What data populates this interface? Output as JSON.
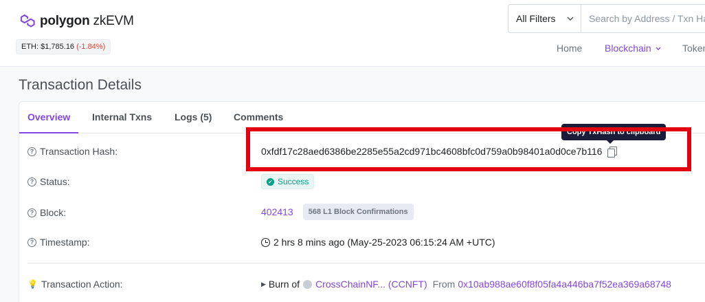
{
  "brand": {
    "name_bold": "polygon",
    "name_rest": "zkEVM",
    "color": "#8247e5"
  },
  "price": {
    "label": "ETH: $1,785.16",
    "change": "(-1.84%)"
  },
  "search": {
    "filter_label": "All Filters",
    "placeholder": "Search by Address / Txn Hash / Block / Token"
  },
  "nav": {
    "items": [
      {
        "label": "Home",
        "active": false
      },
      {
        "label": "Blockchain",
        "active": true
      },
      {
        "label": "Tokens",
        "active": false
      }
    ]
  },
  "page": {
    "title": "Transaction Details"
  },
  "tabs": [
    {
      "label": "Overview",
      "active": true
    },
    {
      "label": "Internal Txns",
      "active": false
    },
    {
      "label": "Logs (5)",
      "active": false
    },
    {
      "label": "Comments",
      "active": false
    }
  ],
  "details": {
    "hash_label": "Transaction Hash:",
    "hash_value": "0xfdf17c28aed6386be2285e55a2cd971bc4608bfc0d759a0b98401a0d0ce7b116",
    "tooltip": "Copy TxHash to clipboard",
    "status_label": "Status:",
    "status_value": "Success",
    "block_label": "Block:",
    "block_value": "402413",
    "block_confirmations": "568 L1 Block Confirmations",
    "timestamp_label": "Timestamp:",
    "timestamp_value": "2 hrs 8 mins ago (May-25-2023 06:15:24 AM +UTC)",
    "action_label": "Transaction Action:",
    "action_prefix": "Burn of",
    "action_token": "CrossChainNF... (CCNFT)",
    "action_from_label": "From",
    "action_from_address": "0x10ab988ae60f8f05fa4a446ba7f52ea369a68748"
  },
  "colors": {
    "accent": "#8247e5",
    "success": "#00a186",
    "negative": "#de4437",
    "highlight": "#e3000f"
  }
}
